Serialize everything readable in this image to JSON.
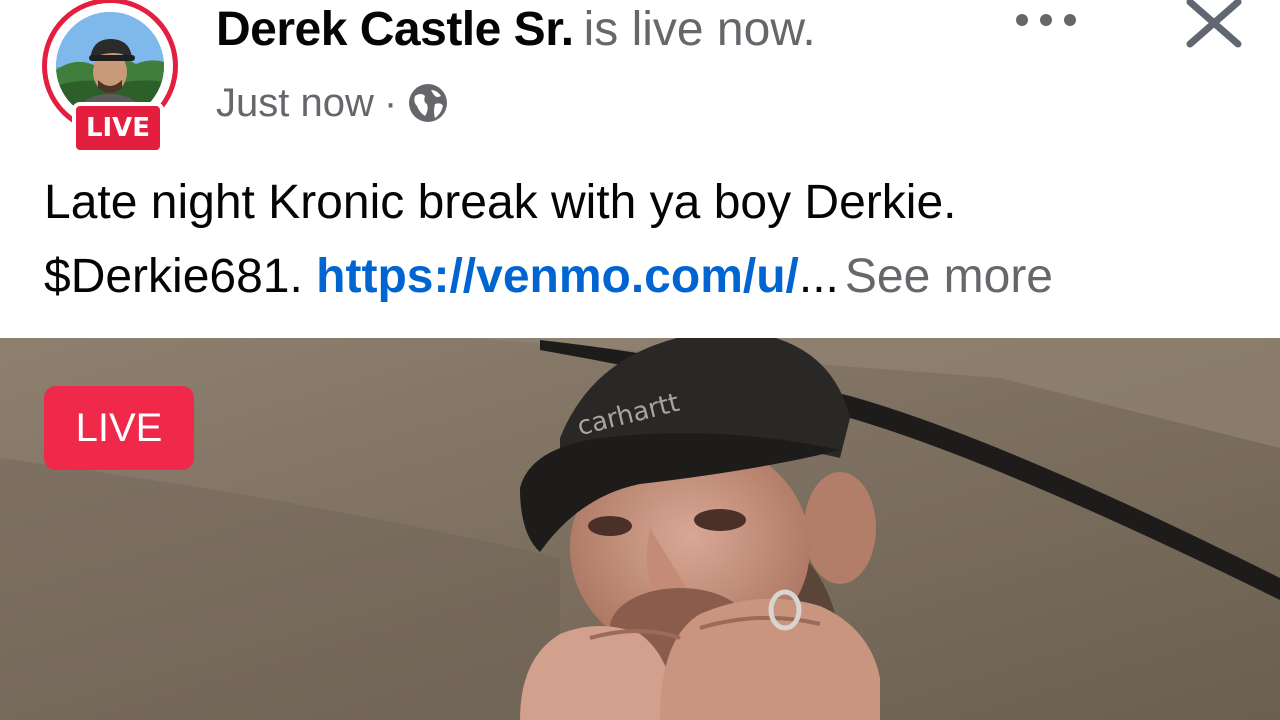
{
  "post": {
    "author_name": "Derek Castle Sr.",
    "status_text": "is live now.",
    "timestamp": "Just now",
    "separator": "·",
    "privacy_icon": "globe-icon",
    "avatar_badge": "LIVE",
    "caption_line1": "Late night Kronic break with ya boy Derkie.",
    "caption_handle": "$Derkie681.",
    "caption_link": "https://venmo.com/u/",
    "caption_ellipsis": "...",
    "see_more": "See more",
    "video_badge": "LIVE",
    "cap_brand_text": "carhartt"
  },
  "icons": {
    "more": "more-horizontal-icon",
    "close": "close-icon"
  },
  "colors": {
    "live_red": "#e41e3f",
    "link_blue": "#0064d1",
    "secondary_text": "#65676b",
    "primary_text": "#050505"
  }
}
